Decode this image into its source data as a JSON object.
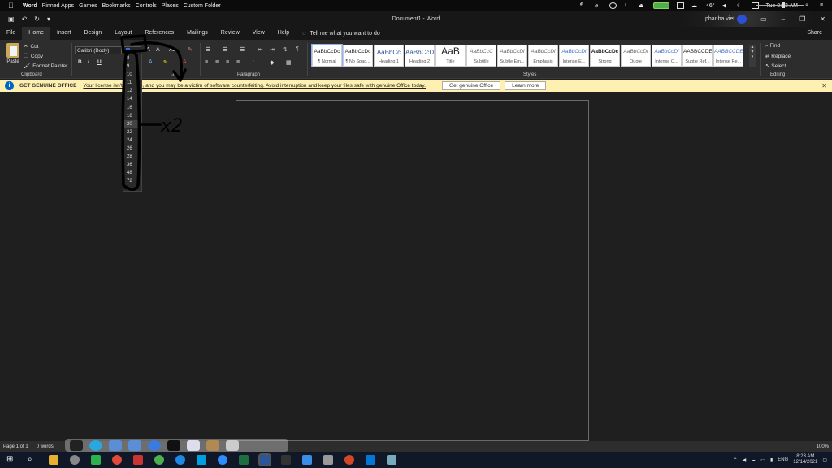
{
  "macbar": {
    "app": "Word",
    "menus": [
      "Pinned Apps",
      "Games",
      "Bookmarks",
      "Controls",
      "Places",
      "Custom Folder"
    ],
    "temp": "46°",
    "clock": "Tue 8:23 AM"
  },
  "titlebar": {
    "title": "Document1  -  Word",
    "user": "phanba viet"
  },
  "tabs": [
    "File",
    "Home",
    "Insert",
    "Design",
    "Layout",
    "References",
    "Mailings",
    "Review",
    "View",
    "Help"
  ],
  "tellme": "Tell me what you want to do",
  "share": "Share",
  "clipboard": {
    "paste": "Paste",
    "cut": "Cut",
    "copy": "Copy",
    "format_painter": "Format Painter",
    "label": "Clipboard"
  },
  "font": {
    "name": "Calibri (Body)",
    "bold": "B",
    "italic": "I",
    "underline": "U"
  },
  "paragraph_label": "Paragraph",
  "styles_label": "Styles",
  "editing": {
    "find": "Find",
    "replace": "Replace",
    "select": "Select",
    "label": "Editing"
  },
  "styles": [
    {
      "sample": "AaBbCcDc",
      "name": "¶ Normal",
      "kind": "normal"
    },
    {
      "sample": "AaBbCcDc",
      "name": "¶ No Spac...",
      "kind": "normal"
    },
    {
      "sample": "AaBbCc",
      "name": "Heading 1",
      "kind": "heading"
    },
    {
      "sample": "AaBbCcD",
      "name": "Heading 2",
      "kind": "heading"
    },
    {
      "sample": "AaB",
      "name": "Title",
      "kind": "big"
    },
    {
      "sample": "AaBbCcC",
      "name": "Subtitle",
      "kind": "subtle"
    },
    {
      "sample": "AaBbCcDi",
      "name": "Subtle Em...",
      "kind": "subtle"
    },
    {
      "sample": "AaBbCcDi",
      "name": "Emphasis",
      "kind": "subtle"
    },
    {
      "sample": "AaBbCcDi",
      "name": "Intense E...",
      "kind": "intense"
    },
    {
      "sample": "AaBbCcDc",
      "name": "Strong",
      "kind": "strong"
    },
    {
      "sample": "AaBbCcDi",
      "name": "Quote",
      "kind": "subtle"
    },
    {
      "sample": "AaBbCcDi",
      "name": "Intense Q...",
      "kind": "intense"
    },
    {
      "sample": "AABBCCDE",
      "name": "Subtle Ref...",
      "kind": "normal"
    },
    {
      "sample": "AABBCCDE",
      "name": "Intense Re...",
      "kind": "intense"
    }
  ],
  "warning": {
    "heading": "GET GENUINE OFFICE",
    "message": "Your license isn't genuine, and you may be a victim of software counterfeiting. Avoid interruption and keep your files safe with genuine Office today.",
    "button": "Get genuine Office",
    "learn": "Learn more"
  },
  "font_sizes": [
    "8",
    "9",
    "10",
    "11",
    "12",
    "14",
    "16",
    "18",
    "20",
    "22",
    "24",
    "26",
    "28",
    "36",
    "48",
    "72"
  ],
  "annotation_text": "x2",
  "status": {
    "page": "Page 1 of 1",
    "words": "0 words",
    "zoom": "100%"
  },
  "taskbar": {
    "lang": "ENG",
    "time": "8:23 AM",
    "date": "12/14/2021"
  }
}
